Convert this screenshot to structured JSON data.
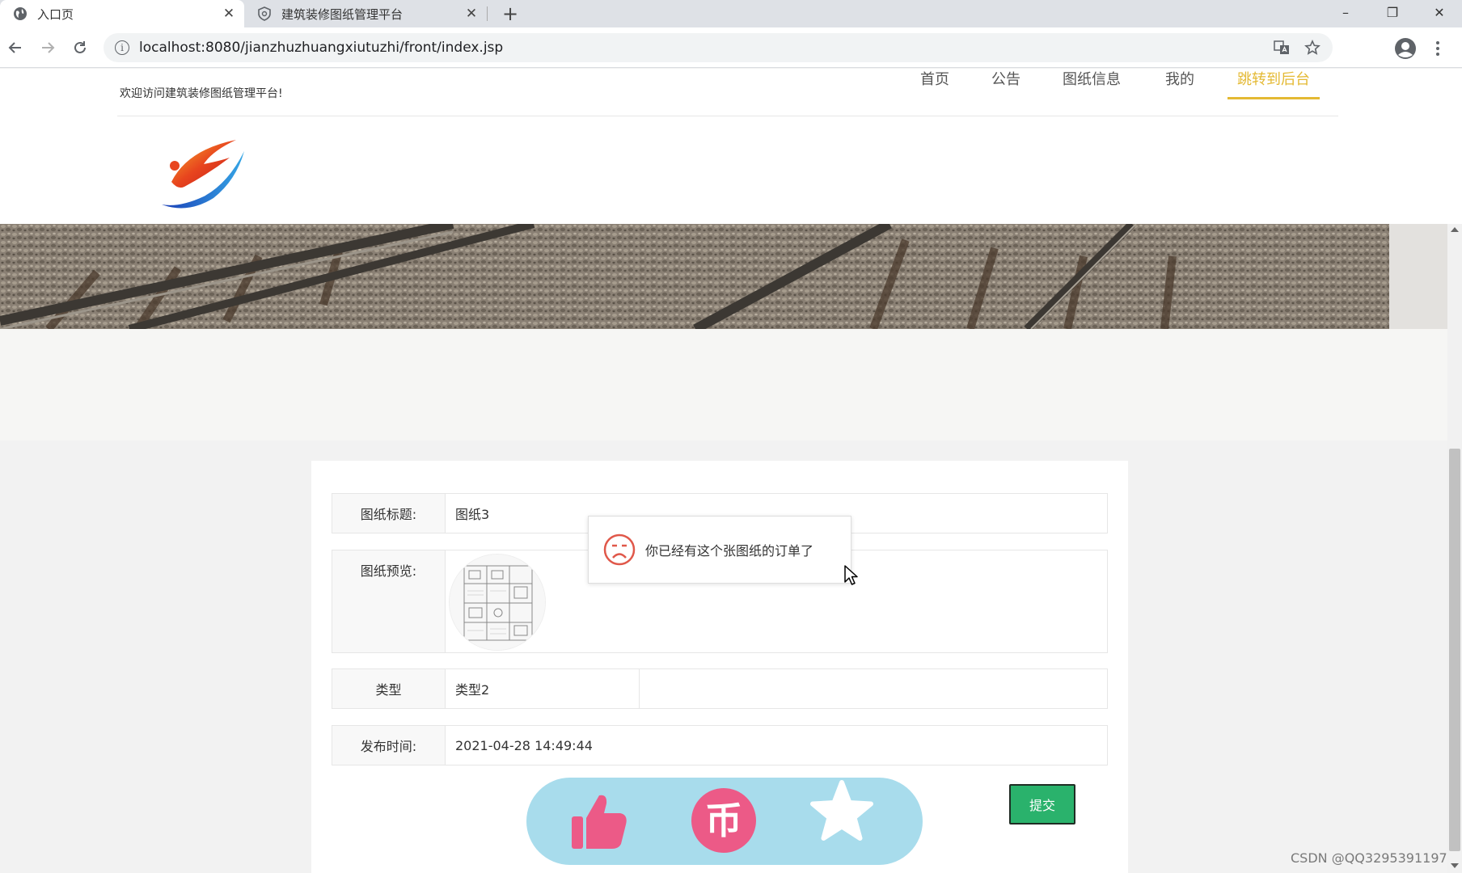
{
  "browser": {
    "tabs": [
      {
        "title": "入口页",
        "icon": "globe-icon",
        "active": true
      },
      {
        "title": "建筑装修图纸管理平台",
        "icon": "shield-icon",
        "active": false
      }
    ],
    "close_glyph": "✕",
    "new_tab_glyph": "+",
    "url": "localhost:8080/jianzhuzhuangxiutuzhi/front/index.jsp",
    "window_controls": {
      "minimize": "–",
      "maximize": "❐",
      "close": "✕"
    }
  },
  "site": {
    "welcome": "欢迎访问建筑装修图纸管理平台!",
    "nav": [
      {
        "label": "首页",
        "active": false
      },
      {
        "label": "公告",
        "active": false
      },
      {
        "label": "图纸信息",
        "active": false
      },
      {
        "label": "我的",
        "active": false
      },
      {
        "label": "跳转到后台",
        "active": true
      }
    ],
    "accent_color": "#e4b933"
  },
  "detail": {
    "fields": {
      "title": {
        "label": "图纸标题:",
        "value": "图纸3"
      },
      "preview": {
        "label": "图纸预览:"
      },
      "type": {
        "label": "类型",
        "value": "类型2"
      },
      "publish_time": {
        "label": "发布时间:",
        "value": "2021-04-28 14:49:44"
      }
    },
    "submit_label": "提交",
    "submit_color": "#2ab26c",
    "actions": {
      "like": "thumbs-up-icon",
      "coin": "coin-icon",
      "favorite": "star-icon",
      "pill_color": "#a8dcec",
      "icon_color": "#ec5a87"
    },
    "coin_glyph": "币"
  },
  "toast": {
    "icon": "sad-face-icon",
    "message": "你已经有这个张图纸的订单了"
  },
  "watermark": "CSDN @QQ3295391197"
}
